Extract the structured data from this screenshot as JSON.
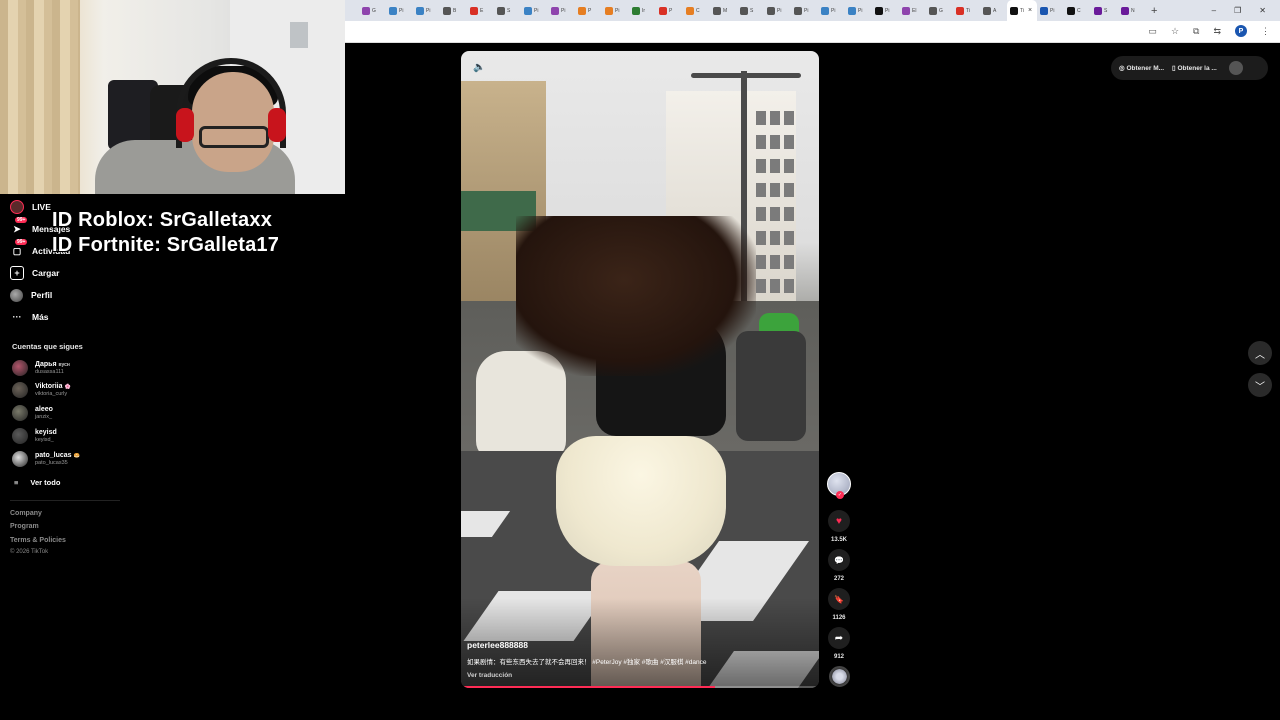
{
  "overlay": {
    "line1": "ID Roblox: SrGalletaxx",
    "line2": "ID Fortnite: SrGalleta17"
  },
  "browser": {
    "tabs": [
      {
        "label": "G",
        "color": "#8e44ad"
      },
      {
        "label": "Pi",
        "color": "#3b82c4"
      },
      {
        "label": "Pi",
        "color": "#3b82c4"
      },
      {
        "label": "B",
        "color": "#555555"
      },
      {
        "label": "E",
        "color": "#d93025"
      },
      {
        "label": "S",
        "color": "#555555"
      },
      {
        "label": "Pi",
        "color": "#3b82c4"
      },
      {
        "label": "Pi",
        "color": "#8e44ad"
      },
      {
        "label": "P",
        "color": "#e67e22"
      },
      {
        "label": "Pi",
        "color": "#e67e22"
      },
      {
        "label": "Ir",
        "color": "#2e7d32"
      },
      {
        "label": "P",
        "color": "#d93025"
      },
      {
        "label": "C",
        "color": "#e67e22"
      },
      {
        "label": "M",
        "color": "#555555"
      },
      {
        "label": "S",
        "color": "#555555"
      },
      {
        "label": "Pi",
        "color": "#555555"
      },
      {
        "label": "Pi",
        "color": "#555555"
      },
      {
        "label": "Pi",
        "color": "#3b82c4"
      },
      {
        "label": "Pi",
        "color": "#3b82c4"
      },
      {
        "label": "Pi",
        "color": "#111111"
      },
      {
        "label": "El",
        "color": "#8e44ad"
      },
      {
        "label": "G",
        "color": "#555555"
      },
      {
        "label": "Ti",
        "color": "#d93025"
      },
      {
        "label": "A",
        "color": "#555555"
      }
    ],
    "active_tab": {
      "label": "Ti",
      "close": "×"
    },
    "tabs_after": [
      {
        "label": "Pi",
        "color": "#1a56b0"
      },
      {
        "label": "C",
        "color": "#111111"
      },
      {
        "label": "S",
        "color": "#6a1b9a"
      },
      {
        "label": "N",
        "color": "#6a1b9a"
      }
    ],
    "new_tab": "+",
    "window_controls": {
      "minimize": "–",
      "restore": "❐",
      "close": "✕"
    },
    "profile_initial": "P"
  },
  "sidebar": {
    "nav": [
      {
        "id": "live",
        "label": "LIVE",
        "icon": "live-icon",
        "glyph": "",
        "badge": ""
      },
      {
        "id": "messages",
        "label": "Mensajes",
        "icon": "paper-plane-icon",
        "glyph": "➤",
        "badge": "99+"
      },
      {
        "id": "activity",
        "label": "Actividad",
        "icon": "inbox-icon",
        "glyph": "▢",
        "badge": "99+"
      },
      {
        "id": "upload",
        "label": "Cargar",
        "icon": "plus-square-icon",
        "glyph": "+",
        "badge": ""
      },
      {
        "id": "profile",
        "label": "Perfil",
        "icon": "avatar-icon",
        "glyph": "",
        "badge": ""
      },
      {
        "id": "more",
        "label": "Más",
        "icon": "more-dots-icon",
        "glyph": "···",
        "badge": ""
      }
    ],
    "following_title": "Cuentas que sigues",
    "following": [
      {
        "name": "Дарья",
        "tag": "вусн",
        "handle": "dusassa111",
        "color": "#b3556b"
      },
      {
        "name": "Viktoriia",
        "tag": "🌸",
        "handle": "viktoria_curly",
        "color": "#6b6258"
      },
      {
        "name": "aleeo",
        "tag": "",
        "handle": "janzix_",
        "color": "#7a7a6a"
      },
      {
        "name": "keyisd",
        "tag": "",
        "handle": "keyisd_",
        "color": "#5a5a5a"
      },
      {
        "name": "pato_lucas",
        "tag": "🥯",
        "handle": "pato_lucas35",
        "color": "#e0e0e0"
      }
    ],
    "see_all": "Ver todo",
    "footer": [
      "Company",
      "Program",
      "Terms & Policies",
      "© 2026 TikTok"
    ]
  },
  "top_right": {
    "btn1": "Obtener M...",
    "btn2": "Obtener la ..."
  },
  "video": {
    "author": "peterlee888888",
    "caption": "如果剧情：有些东西失去了就不会再回来！ #PeterJoy #独家 #歌曲 #汉服棋 #dance",
    "translate": "Ver traducción",
    "progress": 0.71,
    "mute_icon": "🔈"
  },
  "actions": {
    "likes": "13.5K",
    "comments": "272",
    "saves": "1126",
    "shares": "912",
    "like_glyph": "♥",
    "comment_glyph": "💬",
    "save_glyph": "🔖",
    "share_glyph": "➦"
  },
  "arrows": {
    "up": "︿",
    "down": "﹀"
  },
  "colors": {
    "accent": "#fe2c55",
    "background": "#000000"
  }
}
